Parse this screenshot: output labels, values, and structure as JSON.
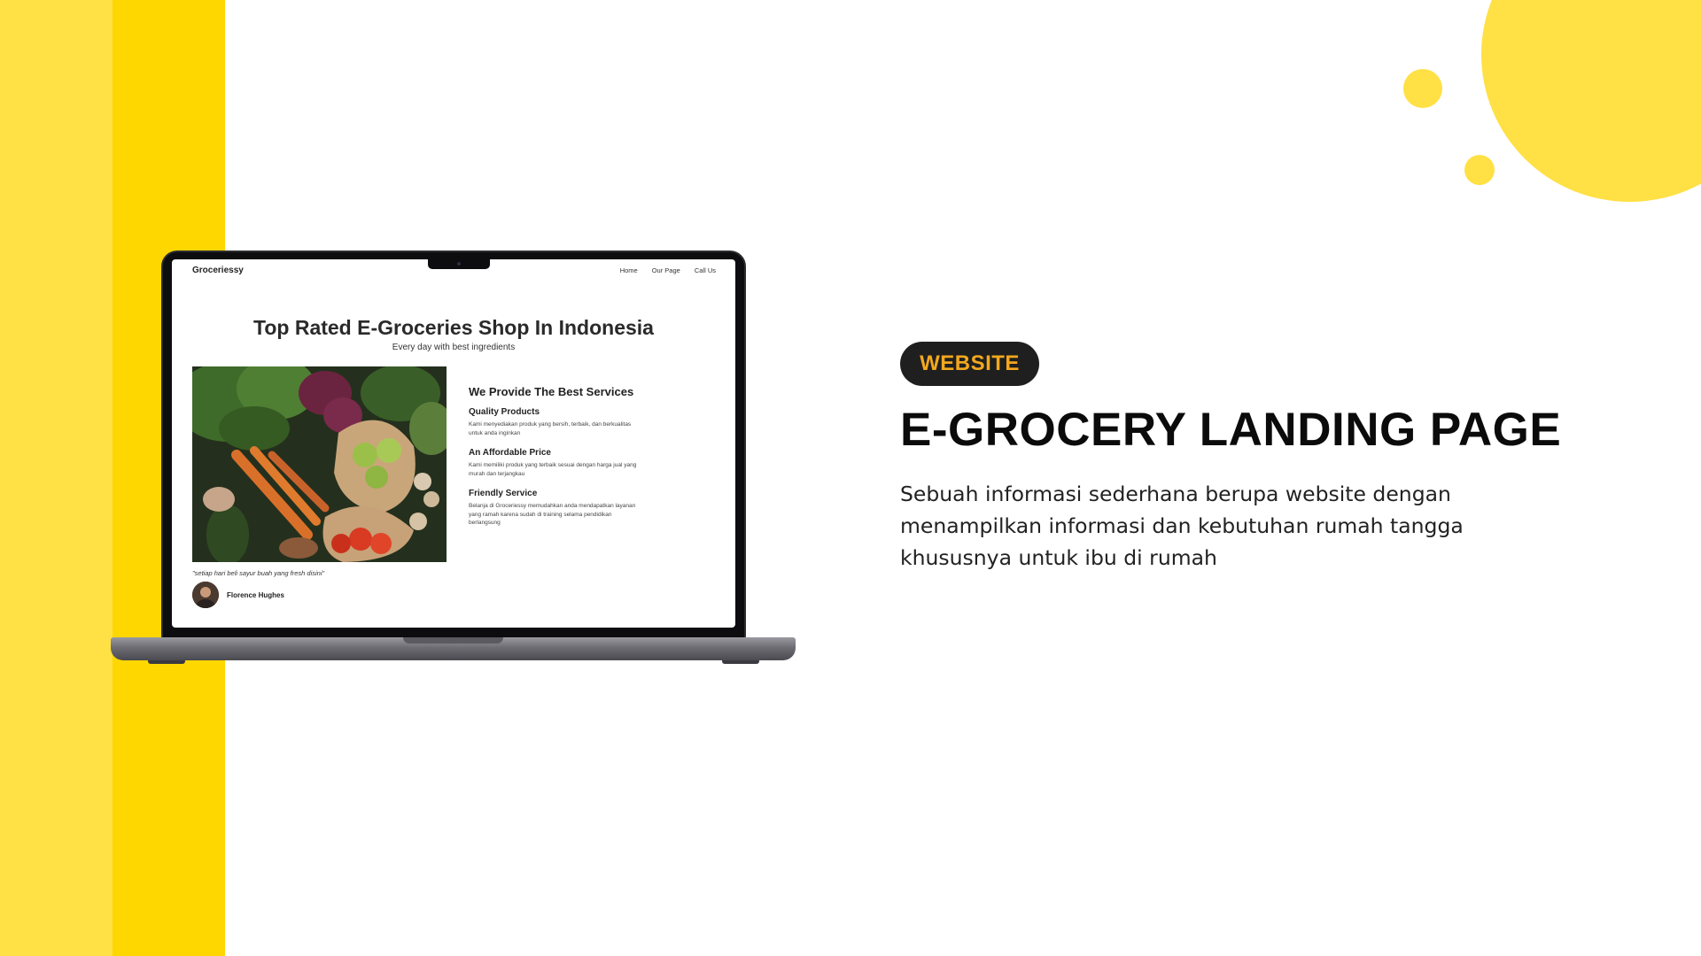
{
  "colors": {
    "yellow_light": "#ffe045",
    "yellow_dark": "#ffd700",
    "badge_bg": "#1f1f1f",
    "badge_text": "#f2a81e",
    "heading": "#0b0b0b"
  },
  "mockup": {
    "site": {
      "logo": "Groceriessy",
      "nav": [
        "Home",
        "Our Page",
        "Call Us"
      ],
      "hero_title": "Top Rated E-Groceries Shop In Indonesia",
      "hero_subtitle": "Every day with best ingredients",
      "services_title": "We Provide The Best Services",
      "services": [
        {
          "title": "Quality Products",
          "text": "Kami menyediakan produk yang bersih, terbaik, dan berkualitas untuk anda inginkan"
        },
        {
          "title": "An Affordable Price",
          "text": "Kami memiliki produk yang terbaik sesuai dengan harga jual yang murah dan terjangkau"
        },
        {
          "title": "Friendly Service",
          "text": "Belanja di Groceriessy memudahkan anda mendapatkan layanan yang ramah karena sudah di training selama pendidikan berlangsung"
        }
      ],
      "testimonial_quote": "\"setiap hari beli sayur buah yang fresh disini\"",
      "testimonial_name": "Florence Hughes",
      "image_icon": "vegetables-photo"
    }
  },
  "project": {
    "badge": "WEBSITE",
    "title": "E-GROCERY LANDING PAGE",
    "description": "Sebuah informasi sederhana berupa website dengan menampilkan informasi dan kebutuhan rumah tangga khususnya untuk ibu di rumah"
  }
}
